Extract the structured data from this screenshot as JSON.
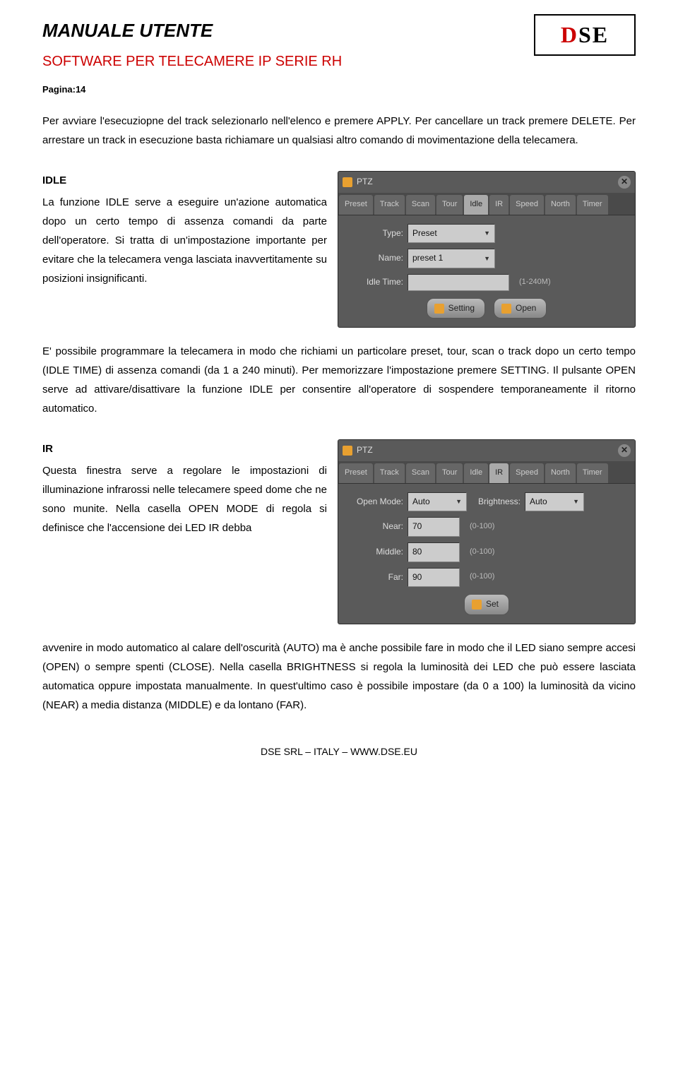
{
  "header": {
    "title": "MANUALE UTENTE",
    "subtitle": "SOFTWARE PER TELECAMERE IP SERIE RH",
    "logo": {
      "d": "D",
      "s": "S",
      "e": "E"
    },
    "page_label": "Pagina:14"
  },
  "intro": "Per avviare l'esecuziopne del track selezionarlo nell'elenco e premere APPLY. Per cancellare un track premere DELETE. Per arrestare un track in esecuzione basta richiamare un qualsiasi altro comando di movimentazione della telecamera.",
  "idle": {
    "heading": "IDLE",
    "left_text": "La funzione IDLE serve a eseguire un'azione automatica dopo un certo tempo di assenza comandi da parte dell'operatore. Si tratta di un'impostazione importante per evitare che la telecamera venga lasciata inavvertitamente su posizioni insignificanti.",
    "after_text": "E' possibile programmare la telecamera in modo che richiami un particolare preset, tour, scan o track dopo un certo tempo (IDLE TIME) di assenza comandi (da 1 a 240 minuti). Per memorizzare l'impostazione premere SETTING. Il pulsante OPEN serve ad attivare/disattivare la funzione IDLE per consentire all'operatore di sospendere temporaneamente il ritorno automatico.",
    "panel": {
      "title": "PTZ",
      "tabs": [
        "Preset",
        "Track",
        "Scan",
        "Tour",
        "Idle",
        "IR",
        "Speed",
        "North",
        "Timer"
      ],
      "active_tab": "Idle",
      "type_label": "Type:",
      "type_value": "Preset",
      "name_label": "Name:",
      "name_value": "preset 1",
      "idle_time_label": "Idle Time:",
      "idle_time_value": "",
      "idle_time_hint": "(1-240M)",
      "btn_setting": "Setting",
      "btn_open": "Open"
    }
  },
  "ir": {
    "heading": "IR",
    "left_text": "Questa finestra serve a regolare le impostazioni di illuminazione infrarossi nelle telecamere speed dome che ne sono munite. Nella casella OPEN MODE di regola si definisce che l'accensione dei LED IR debba",
    "after_text": "avvenire in modo automatico al calare dell'oscurità (AUTO) ma è anche possibile fare in modo che il LED siano sempre accesi (OPEN) o sempre spenti (CLOSE). Nella casella BRIGHTNESS si regola la luminosità dei LED che può essere lasciata automatica oppure impostata manualmente. In quest'ultimo caso è possibile impostare (da 0 a 100) la luminosità da vicino (NEAR) a media distanza (MIDDLE) e da lontano (FAR).",
    "panel": {
      "title": "PTZ",
      "tabs": [
        "Preset",
        "Track",
        "Scan",
        "Tour",
        "Idle",
        "IR",
        "Speed",
        "North",
        "Timer"
      ],
      "active_tab": "IR",
      "open_mode_label": "Open Mode:",
      "open_mode_value": "Auto",
      "brightness_label": "Brightness:",
      "brightness_value": "Auto",
      "near_label": "Near:",
      "near_value": "70",
      "near_hint": "(0-100)",
      "middle_label": "Middle:",
      "middle_value": "80",
      "middle_hint": "(0-100)",
      "far_label": "Far:",
      "far_value": "90",
      "far_hint": "(0-100)",
      "btn_set": "Set"
    }
  },
  "footer": "DSE SRL – ITALY – WWW.DSE.EU"
}
